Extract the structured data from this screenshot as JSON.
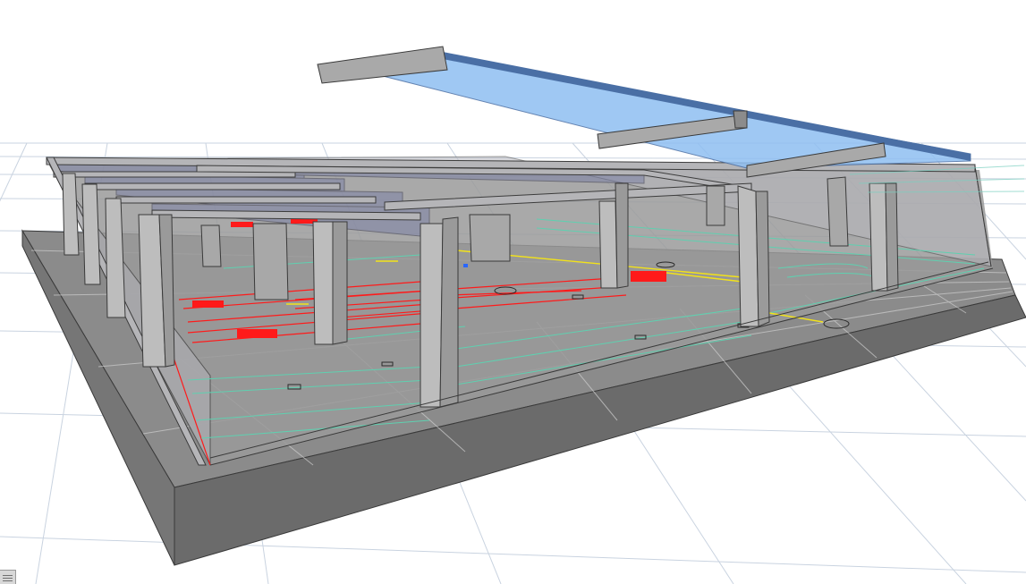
{
  "viewport": {
    "label": "",
    "background": "#ffffff"
  },
  "colors": {
    "grid_line": "#c9d3e0",
    "slab_top": "#8b8b8b",
    "slab_side": "#6b6b6b",
    "concrete_light": "#bdbdbd",
    "concrete_mid": "#a2a2a2",
    "concrete_dark": "#7e7e7e",
    "glass_fill": "#8fbff2",
    "glass_edge": "#4a6fa5",
    "room_tint": "#7d82a6",
    "mep_red": "#ff1a1a",
    "mep_teal": "#5fd0b0",
    "mep_yellow": "#f2e21a",
    "mep_blue": "#2a66ff"
  },
  "icons": {
    "corner": "view-cube-corner-icon"
  }
}
